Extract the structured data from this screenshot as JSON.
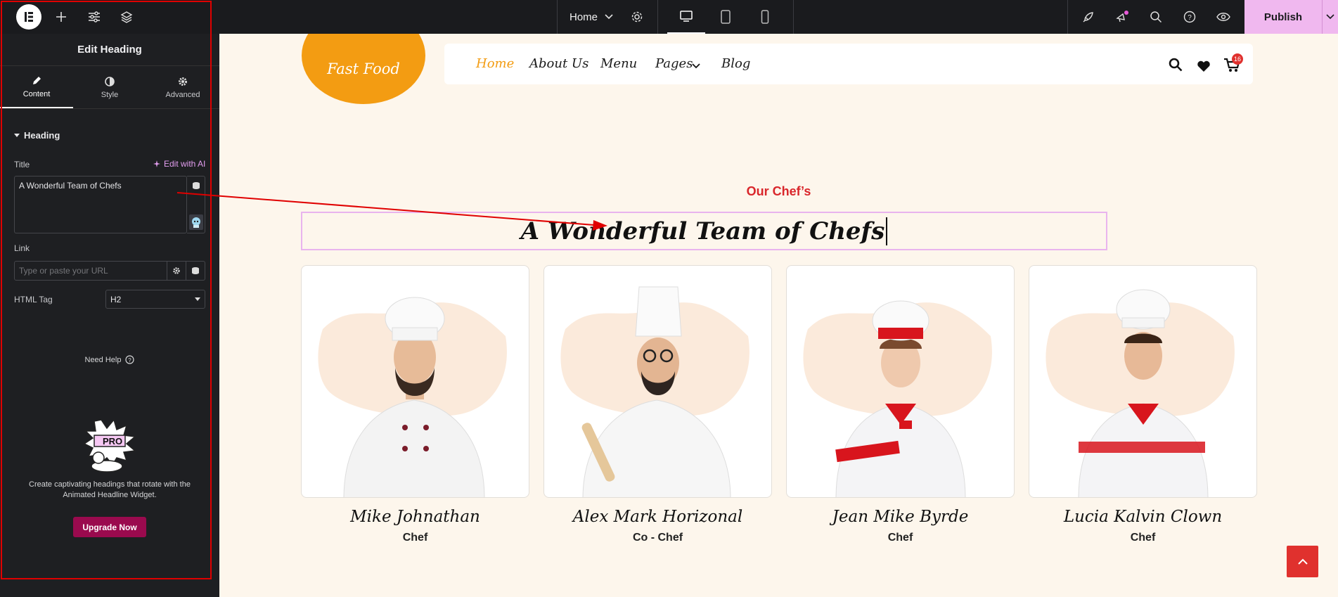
{
  "topbar": {
    "page_name": "Home",
    "publish_label": "Publish",
    "icons": [
      "elementor-logo-icon",
      "plus-icon",
      "sliders-icon",
      "layers-icon",
      "chevron-down-icon",
      "gear-icon",
      "desktop-icon",
      "tablet-icon",
      "mobile-icon",
      "rocket-icon",
      "notifications-icon",
      "search-icon",
      "help-icon",
      "eye-icon"
    ]
  },
  "panel": {
    "title": "Edit Heading",
    "tabs": [
      {
        "label": "Content",
        "icon": "pencil-icon",
        "active": true
      },
      {
        "label": "Style",
        "icon": "half-circle-icon",
        "active": false
      },
      {
        "label": "Advanced",
        "icon": "gear-icon",
        "active": false
      }
    ],
    "section_title": "Heading",
    "title_label": "Title",
    "edit_ai_label": "Edit with AI",
    "title_value": "A Wonderful Team of Chefs",
    "link_label": "Link",
    "link_placeholder": "Type or paste your URL",
    "html_tag_label": "HTML Tag",
    "html_tag_value": "H2",
    "need_help": "Need Help",
    "pro_badge": "PRO",
    "promo_text": "Create captivating headings that rotate with the Animated Headline Widget.",
    "upgrade_label": "Upgrade Now"
  },
  "site": {
    "logo_text": "Fast Food",
    "nav": [
      {
        "label": "Home",
        "active": true
      },
      {
        "label": "About Us",
        "active": false
      },
      {
        "label": "Menu",
        "active": false
      },
      {
        "label": "Pages",
        "active": false
      },
      {
        "label": "Blog",
        "active": false
      }
    ],
    "cart_count": "16",
    "subtitle": "Our Chef’s",
    "heading": "A Wonderful Team of Chefs",
    "chefs": [
      {
        "name": "Mike Johnathan",
        "role": "Chef"
      },
      {
        "name": "Alex Mark Horizonal",
        "role": "Co - Chef"
      },
      {
        "name": "Jean Mike Byrde",
        "role": "Chef"
      },
      {
        "name": "Lucia Kalvin Clown",
        "role": "Chef"
      }
    ]
  },
  "colors": {
    "accent_orange": "#f39c12",
    "accent_red": "#d9262b",
    "publish_pink": "#f0b8ef",
    "upgrade_magenta": "#9a0a4e",
    "annotation_red": "#e00000"
  }
}
